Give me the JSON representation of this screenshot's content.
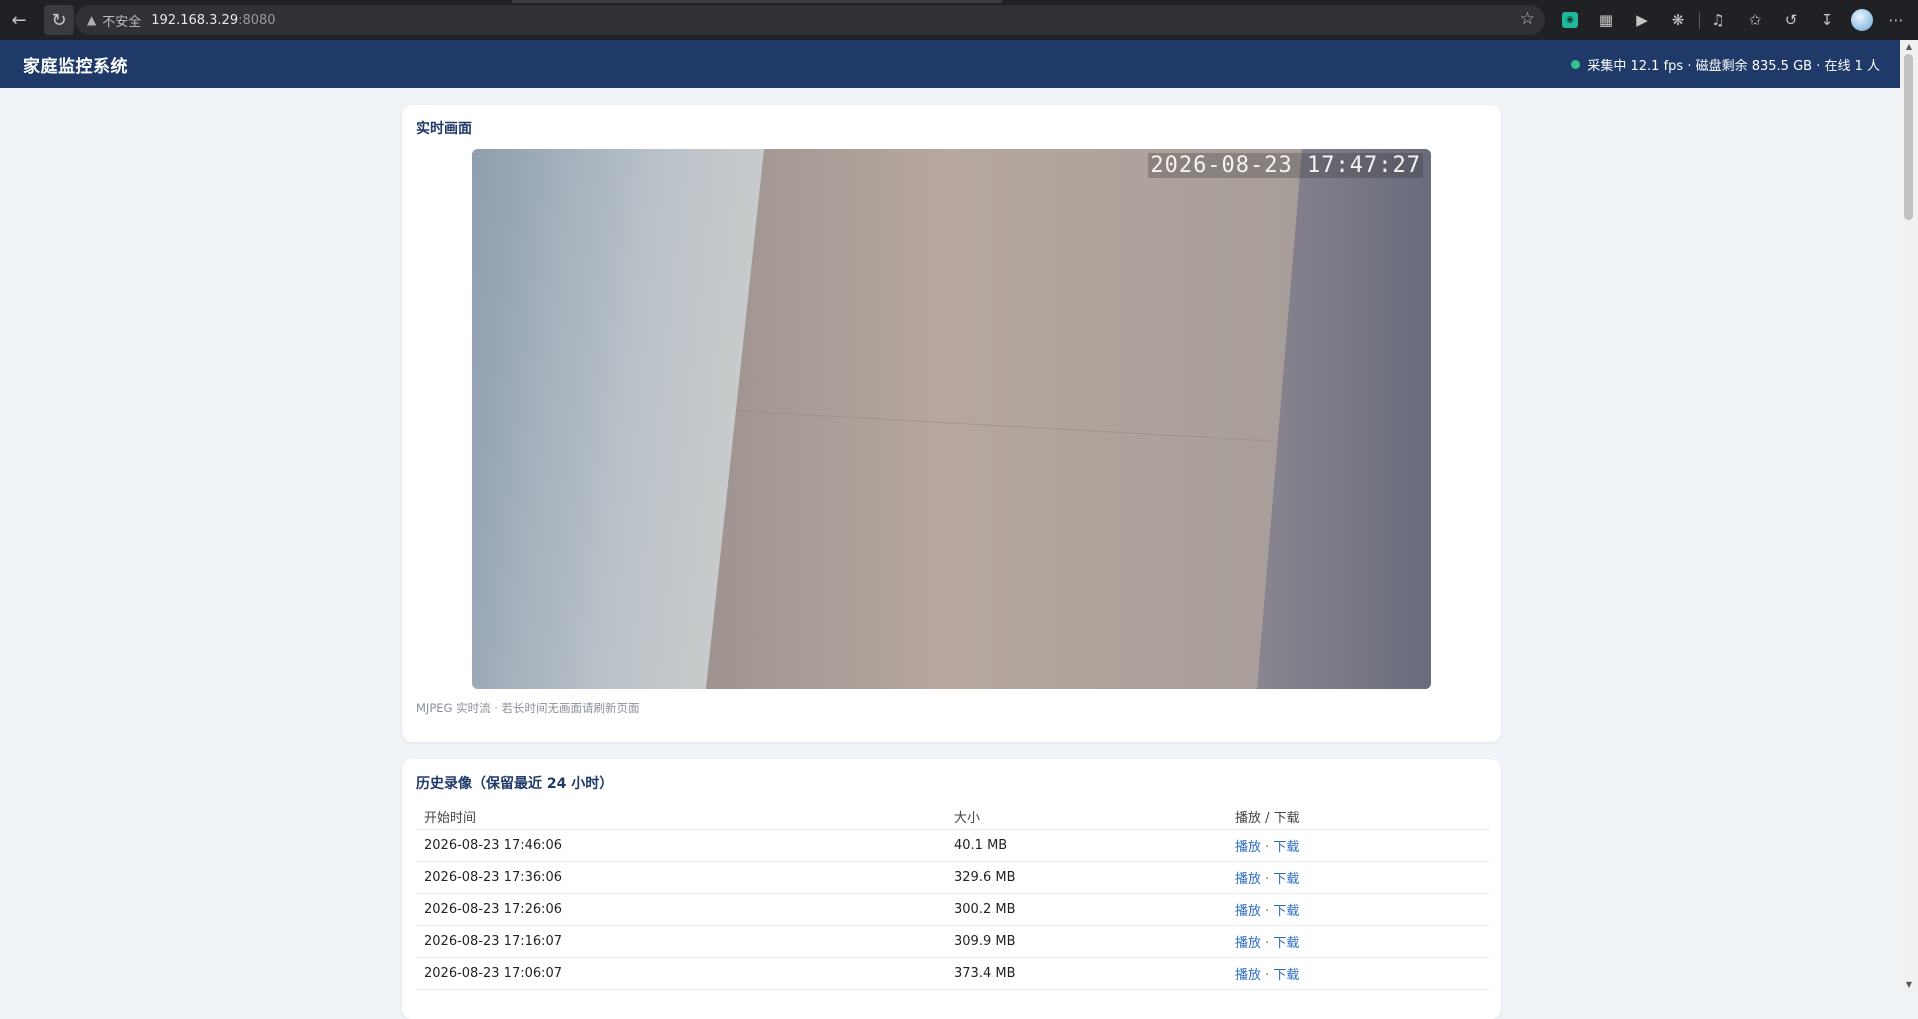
{
  "browser": {
    "security_label": "不安全",
    "url_host": "192.168.3.29",
    "url_port": ":8080"
  },
  "header": {
    "title": "家庭监控系统",
    "status_text": "采集中 12.1 fps · 磁盘剩余 835.5 GB · 在线 1 人",
    "status_color": "#34c38f"
  },
  "live": {
    "title": "实时画面",
    "overlay_timestamp": "2026-08-23 17:47:27",
    "caption": "MJPEG 实时流 · 若长时间无画面请刷新页面"
  },
  "history": {
    "title": "历史录像（保留最近 24 小时）",
    "columns": [
      "开始时间",
      "大小",
      "播放 / 下载"
    ],
    "play_label": "播放",
    "separator": " · ",
    "download_label": "下载",
    "rows": [
      {
        "start": "2026-08-23 17:46:06",
        "size": "40.1 MB"
      },
      {
        "start": "2026-08-23 17:36:06",
        "size": "329.6 MB"
      },
      {
        "start": "2026-08-23 17:26:06",
        "size": "300.2 MB"
      },
      {
        "start": "2026-08-23 17:16:07",
        "size": "309.9 MB"
      },
      {
        "start": "2026-08-23 17:06:07",
        "size": "373.4 MB"
      }
    ]
  }
}
